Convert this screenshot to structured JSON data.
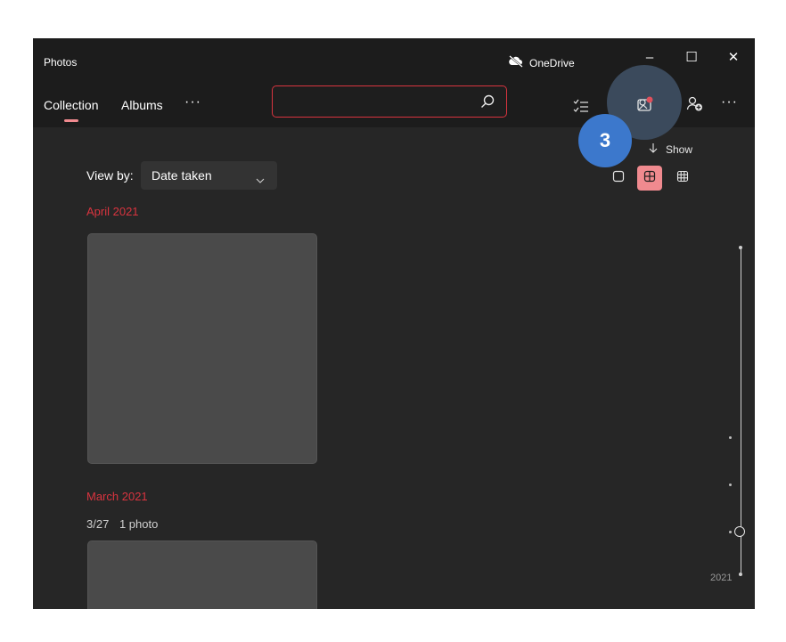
{
  "window": {
    "title": "Photos",
    "onedrive_label": "OneDrive",
    "controls": {
      "minimize": "–",
      "maximize": "☐",
      "close": "✕"
    }
  },
  "toolbar": {
    "tabs": [
      {
        "label": "Collection",
        "active": true
      },
      {
        "label": "Albums",
        "active": false
      }
    ],
    "more_tabs": "···",
    "search": {
      "value": "",
      "placeholder": ""
    },
    "icons": [
      "select-icon",
      "import-photos-icon",
      "add-people-icon",
      "more-options-icon"
    ],
    "more_options": "···"
  },
  "tutorial": {
    "step_number": "3"
  },
  "view": {
    "show_label": "Show",
    "view_by_label": "View by:",
    "view_by_value": "Date taken",
    "size_options": [
      "large",
      "medium",
      "small"
    ],
    "selected_size": "medium"
  },
  "groups": [
    {
      "header": "April 2021"
    },
    {
      "header": "March 2021",
      "date": "3/27",
      "count": "1 photo"
    }
  ],
  "timeline": {
    "year": "2021"
  },
  "colors": {
    "accent": "#d9343f",
    "accent_light": "#f08a8f",
    "badge": "#3c78cc"
  }
}
